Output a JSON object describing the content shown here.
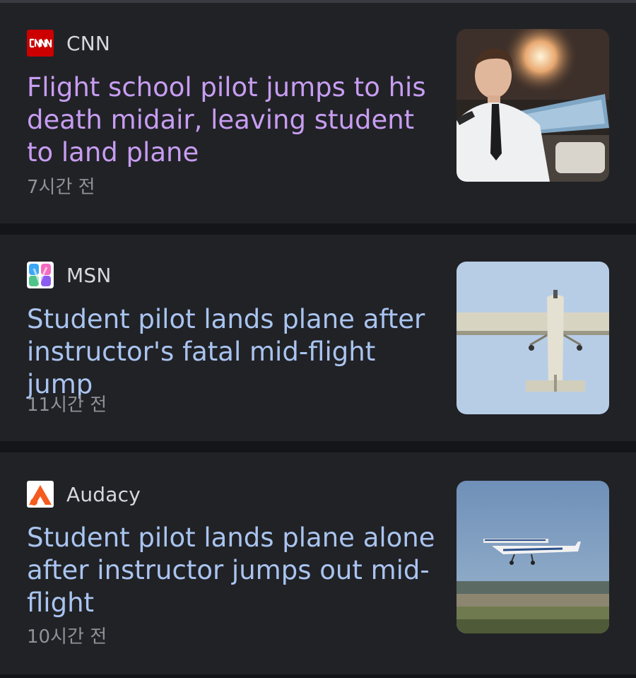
{
  "articles": [
    {
      "source": "CNN",
      "logo_icon": "cnn-logo-icon",
      "title": "Flight school pilot jumps to his death midair, leaving student to land plane",
      "time": "7시간 전",
      "visited": true,
      "thumbnail": "pilot-in-cockpit-image"
    },
    {
      "source": "MSN",
      "logo_icon": "msn-logo-icon",
      "title": "Student pilot lands plane after instructor's fatal mid-flight jump",
      "time": "11시간 전",
      "visited": false,
      "thumbnail": "plane-underside-image"
    },
    {
      "source": "Audacy",
      "logo_icon": "audacy-logo-icon",
      "title": "Student pilot lands plane alone after instructor jumps out mid-flight",
      "time": "10시간 전",
      "visited": false,
      "thumbnail": "plane-over-airfield-image"
    }
  ],
  "colors": {
    "background": "#17181c",
    "card": "#212226",
    "visited_headline": "#c79df2",
    "headline": "#a9c4f0",
    "timestamp": "#8f9297",
    "cnn_red": "#cc0000",
    "audacy_orange": "#f55a1f"
  }
}
